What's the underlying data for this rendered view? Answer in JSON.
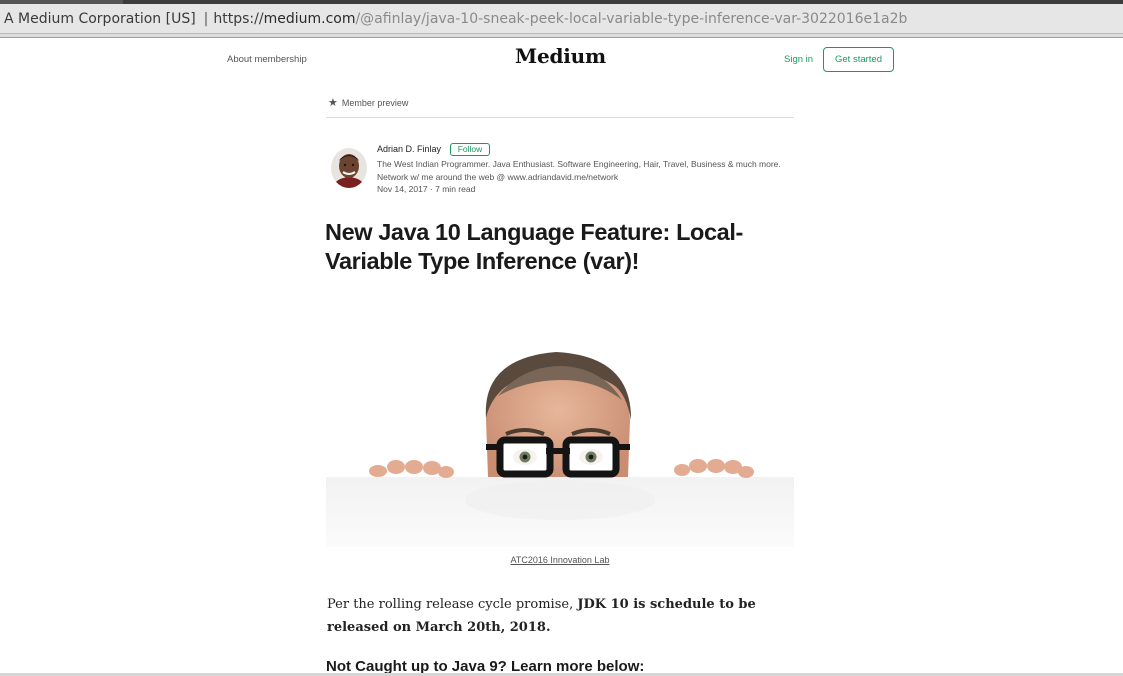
{
  "browser": {
    "certificate": "A Medium Corporation [US]",
    "separator": "|",
    "url_scheme": "https://",
    "url_host": "medium.com",
    "url_path": "/@afinlay/java-10-sneak-peek-local-variable-type-inference-var-3022016e1a2b"
  },
  "header": {
    "about_label": "About membership",
    "logo": "Medium",
    "signin_label": "Sign in",
    "get_started_label": "Get started",
    "accent_color": "#1c9963"
  },
  "article": {
    "member_preview": "Member preview",
    "author": {
      "name": "Adrian D. Finlay",
      "follow_label": "Follow",
      "bio": "The West Indian Programmer. Java Enthusiast. Software Engineering, Hair, Travel, Business & much more. Network w/ me around the web @ www.adriandavid.me/network",
      "date": "Nov 14, 2017",
      "dot": " · ",
      "read_time": "7 min read"
    },
    "title": "New Java 10 Language Feature: Local-Variable Type Inference (var)!",
    "image_caption": "ATC2016 Innovation Lab",
    "body_intro": "Per the rolling release cycle promise, ",
    "body_bold": "JDK 10 is schedule to be released on March 20th, 2018.",
    "subheading": "Not Caught up to Java 9? Learn more below:"
  }
}
